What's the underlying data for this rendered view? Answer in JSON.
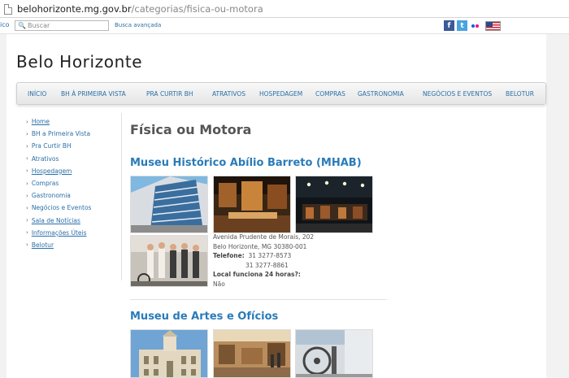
{
  "browser": {
    "url_host": "belohorizonte.mg.gov.br",
    "url_path": "/categorias/fisica-ou-motora"
  },
  "topbar": {
    "cut_link": "ico",
    "search_placeholder": "Buscar",
    "advanced_search": "Busca avançada",
    "social": [
      "facebook",
      "twitter",
      "flickr",
      "english-flag"
    ]
  },
  "site": {
    "title": "Belo Horizonte"
  },
  "nav": {
    "items": [
      "INÍCIO",
      "BH À PRIMEIRA VISTA",
      "PRA CURTIR BH",
      "ATRATIVOS",
      "HOSPEDAGEM",
      "COMPRAS",
      "GASTRONOMIA",
      "NEGÓCIOS E EVENTOS",
      "BELOTUR"
    ]
  },
  "sidebar": {
    "items": [
      {
        "label": "Home",
        "underline": true
      },
      {
        "label": "BH a Primeira Vista",
        "underline": false
      },
      {
        "label": "Pra Curtir BH",
        "underline": false
      },
      {
        "label": "Atrativos",
        "underline": false
      },
      {
        "label": "Hospedagem",
        "underline": true
      },
      {
        "label": "Compras",
        "underline": false
      },
      {
        "label": "Gastronomia",
        "underline": false
      },
      {
        "label": "Negócios e Eventos",
        "underline": false
      },
      {
        "label": "Sala de Notícias",
        "underline": true
      },
      {
        "label": "Informações Úteis",
        "underline": true
      },
      {
        "label": "Belotur",
        "underline": true
      }
    ]
  },
  "content": {
    "page_title": "Física ou Motora",
    "museums": [
      {
        "name": "Museu Histórico Abílio Barreto (MHAB)",
        "address_line1": "Avenida Prudente de Morais, 202",
        "address_line2": "Belo Horizonte, MG 30380-001",
        "phone_label": "Telefone:",
        "phone1": "31 3277-8573",
        "phone2": "31 3277-8861",
        "open24_label": "Local funciona 24 horas?:",
        "open24_value": "Não"
      },
      {
        "name": "Museu de Artes e Ofícios"
      }
    ]
  },
  "colors": {
    "link": "#2a6fa8",
    "museum_title": "#2a7bb8"
  }
}
